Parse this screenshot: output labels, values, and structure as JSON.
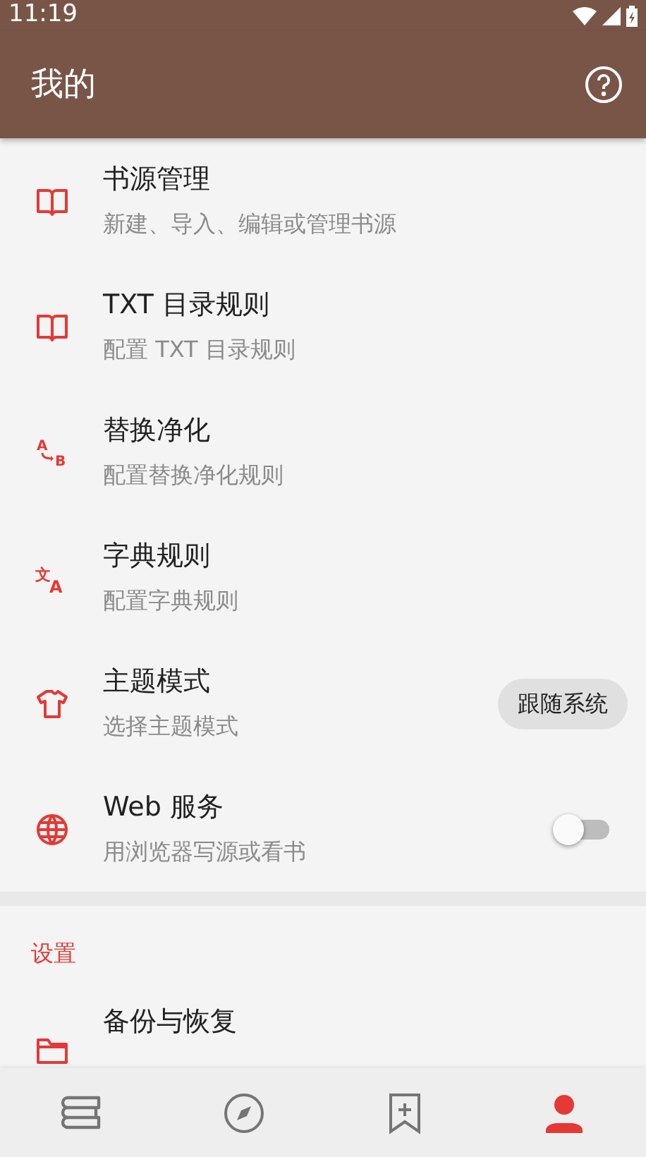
{
  "status_bar": {
    "time": "11:19"
  },
  "toolbar": {
    "title": "我的"
  },
  "items": [
    {
      "kind": "plain",
      "title": "书源管理",
      "subtitle": "新建、导入、编辑或管理书源"
    },
    {
      "kind": "plain",
      "title": "TXT 目录规则",
      "subtitle": "配置 TXT 目录规则"
    },
    {
      "kind": "plain",
      "icon_glyphs": [
        "A",
        "B"
      ],
      "title": "替换净化",
      "subtitle": "配置替换净化规则"
    },
    {
      "kind": "plain",
      "icon_glyphs": [
        "文",
        "A"
      ],
      "title": "字典规则",
      "subtitle": "配置字典规则"
    },
    {
      "kind": "chip",
      "title": "主题模式",
      "subtitle": "选择主题模式",
      "value": "跟随系统"
    },
    {
      "kind": "switch",
      "title": "Web 服务",
      "subtitle": "用浏览器写源或看书",
      "on": false
    }
  ],
  "section": {
    "header": "设置",
    "items": [
      {
        "title": "备份与恢复"
      }
    ]
  },
  "bottom_nav": [
    {
      "selected": false
    },
    {
      "selected": false
    },
    {
      "selected": false
    },
    {
      "selected": true
    }
  ]
}
